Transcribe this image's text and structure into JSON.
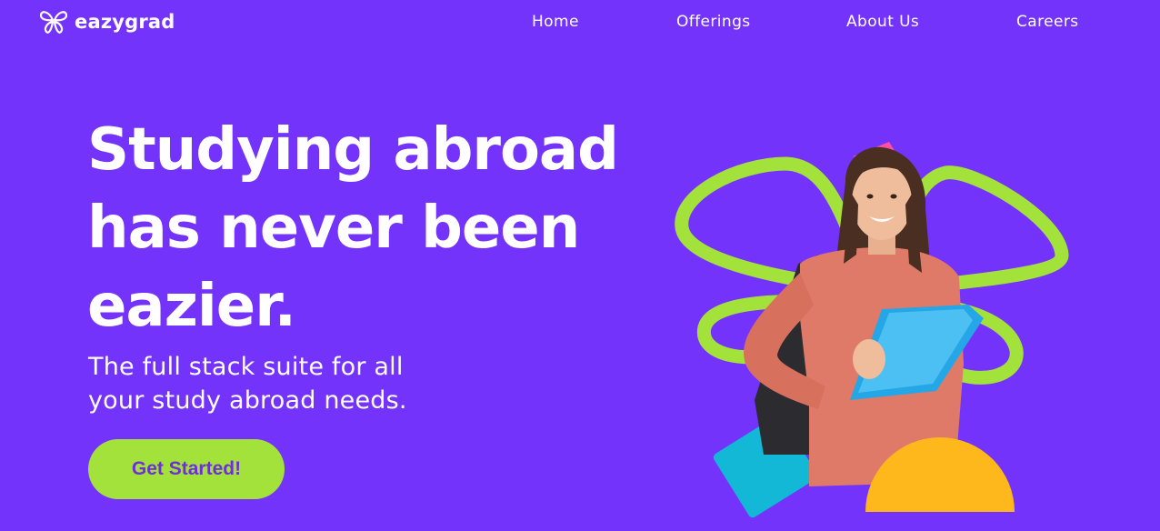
{
  "brand": {
    "name": "eazygrad",
    "icon": "butterfly-logo-icon"
  },
  "nav": {
    "items": [
      {
        "label": "Home"
      },
      {
        "label": "Offerings"
      },
      {
        "label": "About Us"
      },
      {
        "label": "Careers"
      }
    ]
  },
  "hero": {
    "headline_lines": [
      "Studying abroad",
      "has never been",
      "eazier."
    ],
    "subline_lines": [
      "The full stack suite for all",
      "your study abroad needs."
    ],
    "cta_label": "Get Started!",
    "image_icon": "student-with-books-illustration"
  },
  "colors": {
    "background": "#7433fb",
    "accent_green": "#a3e23b",
    "cta_text": "#6f2fd8",
    "shape_pink": "#ff4fa3",
    "shape_cyan": "#12b8d6",
    "shape_yellow": "#ffb81c"
  }
}
